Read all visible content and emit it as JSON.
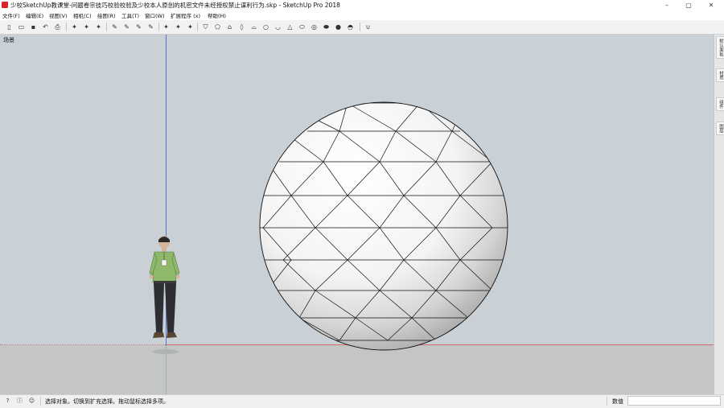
{
  "window": {
    "title": "少校SketchUp教课堂-问题卷宗技巧校验校验及少校本人原创的机密文件未经授权禁止谋利行为.skp - SketchUp Pro 2018",
    "minimize_glyph": "–",
    "restore_glyph": "▢",
    "close_glyph": "✕"
  },
  "menu": [
    "文件(F)",
    "编辑(E)",
    "视图(V)",
    "相机(C)",
    "绘图(R)",
    "工具(T)",
    "窗口(W)",
    "扩展程序 (x)",
    "帮助(H)"
  ],
  "toolbar": {
    "group1": [
      {
        "icon": "new-file-icon",
        "glyph": "▯"
      },
      {
        "icon": "open-file-icon",
        "glyph": "▭"
      },
      {
        "icon": "save-icon",
        "glyph": "▪"
      },
      {
        "icon": "undo-icon",
        "glyph": "↶"
      },
      {
        "icon": "print-icon",
        "glyph": "⎙"
      }
    ],
    "group2": [
      {
        "icon": "select-tool-icon",
        "glyph": "✦"
      },
      {
        "icon": "paint-tool-icon",
        "glyph": "✦"
      },
      {
        "icon": "eraser-tool-icon",
        "glyph": "✦"
      }
    ],
    "group3": [
      {
        "icon": "line-tool-icon",
        "glyph": "✎"
      },
      {
        "icon": "arc-tool-icon",
        "glyph": "✎"
      },
      {
        "icon": "rectangle-tool-icon",
        "glyph": "✎"
      },
      {
        "icon": "push-pull-tool-icon",
        "glyph": "✎"
      }
    ],
    "group4": [
      {
        "icon": "move-tool-icon",
        "glyph": "✦"
      },
      {
        "icon": "rotate-tool-icon",
        "glyph": "✦"
      },
      {
        "icon": "scale-tool-icon",
        "glyph": "✦"
      }
    ],
    "group5": [
      {
        "icon": "shape-shield-icon",
        "glyph": "⛉"
      },
      {
        "icon": "shape-pentagon-icon",
        "glyph": "⬠"
      },
      {
        "icon": "shape-cone-icon",
        "glyph": "⌂"
      },
      {
        "icon": "shape-drop-icon",
        "glyph": "◊"
      },
      {
        "icon": "shape-cylinder-icon",
        "glyph": "⌓"
      },
      {
        "icon": "shape-circle-icon",
        "glyph": "○"
      },
      {
        "icon": "shape-cup-icon",
        "glyph": "◡"
      },
      {
        "icon": "shape-triangle-icon",
        "glyph": "△"
      },
      {
        "icon": "shape-ellipse-icon",
        "glyph": "⬭"
      },
      {
        "icon": "shape-torus-icon",
        "glyph": "◎"
      },
      {
        "icon": "shape-disc-icon",
        "glyph": "⬬"
      },
      {
        "icon": "shape-sphere-icon",
        "glyph": "●"
      },
      {
        "icon": "shape-half-sphere-icon",
        "glyph": "◓"
      }
    ],
    "group6": [
      {
        "icon": "magnet-icon",
        "glyph": "∪"
      }
    ]
  },
  "viewport": {
    "scene_label": "场景",
    "sky_color": "#c9d1d6",
    "ground_color": "#c4c6c6",
    "axis_colors": {
      "red": "#d46a6a",
      "green": "#6fa86f",
      "blue": "#5a73c2"
    }
  },
  "tray": {
    "tabs": [
      "默认面板",
      "材质",
      "组件",
      "图层"
    ]
  },
  "status": {
    "icons": [
      {
        "icon": "geo-location-icon",
        "glyph": "?"
      },
      {
        "icon": "credits-icon",
        "glyph": "ⓘ"
      },
      {
        "icon": "user-account-icon",
        "glyph": "☺"
      }
    ],
    "hint": "选择对象。切换到扩充选择。拖动鼠标选择多项。",
    "measure_label": "数值",
    "measure_value": ""
  }
}
